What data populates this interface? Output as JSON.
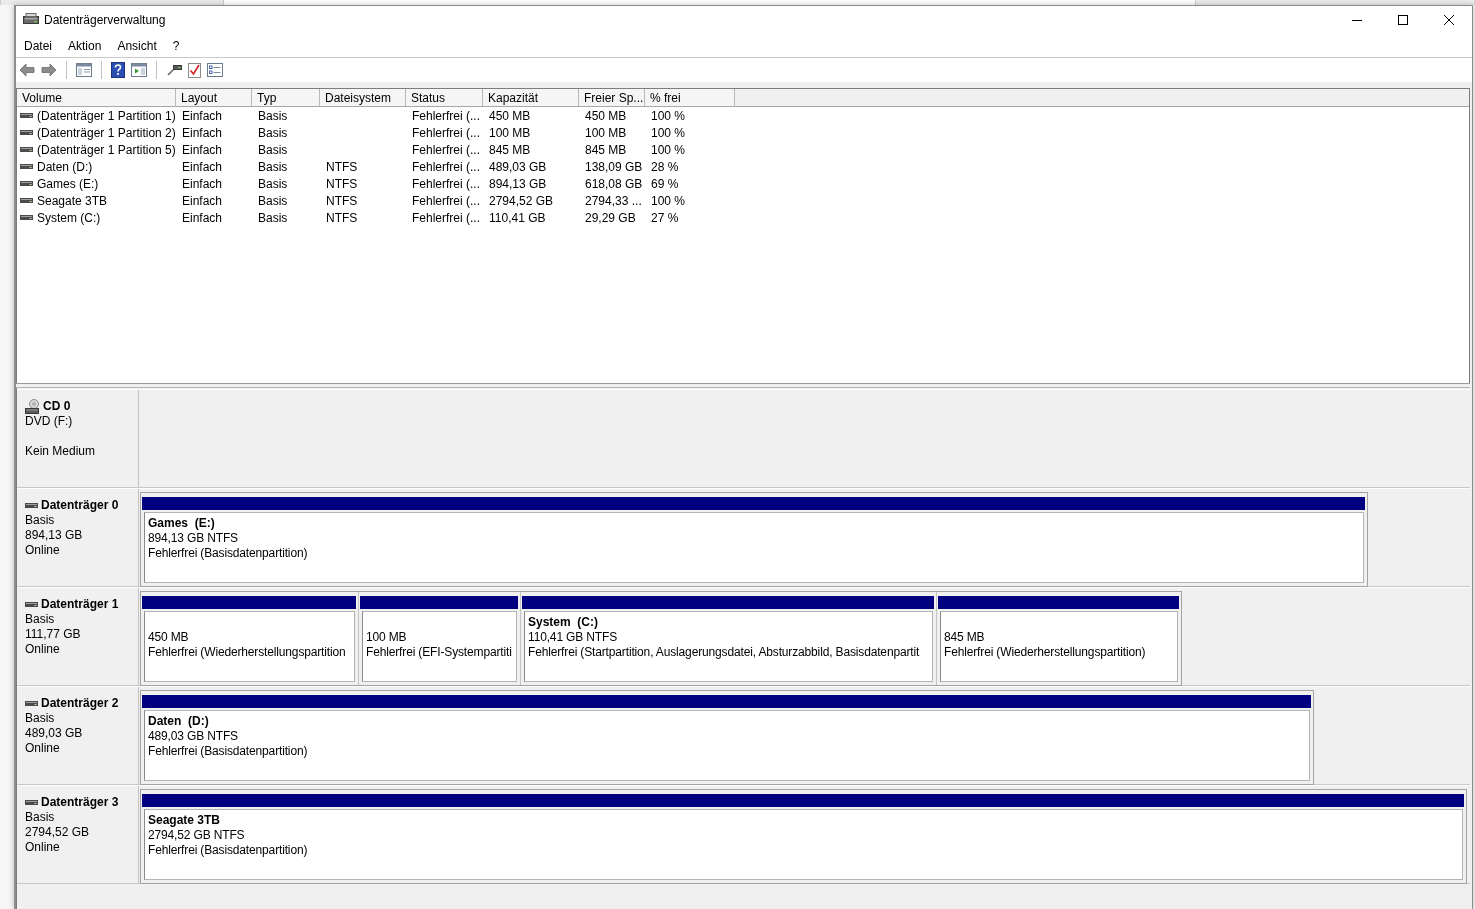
{
  "window": {
    "title": "Datenträgerverwaltung"
  },
  "menu": [
    "Datei",
    "Aktion",
    "Ansicht",
    "?"
  ],
  "volume_list": {
    "columns": [
      "Volume",
      "Layout",
      "Typ",
      "Dateisystem",
      "Status",
      "Kapazität",
      "Freier Sp...",
      "% frei"
    ],
    "rows": [
      {
        "volume": "(Datenträger 1 Partition 1)",
        "layout": "Einfach",
        "type": "Basis",
        "status": "Fehlerfrei (...",
        "capacity": "450 MB",
        "free_space": "450 MB",
        "percent_free": "100 %"
      },
      {
        "volume": "(Datenträger 1 Partition 2)",
        "layout": "Einfach",
        "type": "Basis",
        "status": "Fehlerfrei (...",
        "capacity": "100 MB",
        "free_space": "100 MB",
        "percent_free": "100 %"
      },
      {
        "volume": "(Datenträger 1 Partition 5)",
        "layout": "Einfach",
        "type": "Basis",
        "status": "Fehlerfrei (...",
        "capacity": "845 MB",
        "free_space": "845 MB",
        "percent_free": "100 %"
      },
      {
        "volume": "Daten (D:)",
        "layout": "Einfach",
        "type": "Basis",
        "file_system": "NTFS",
        "status": "Fehlerfrei (...",
        "capacity": "489,03 GB",
        "free_space": "138,09 GB",
        "percent_free": "28 %"
      },
      {
        "volume": "Games (E:)",
        "layout": "Einfach",
        "type": "Basis",
        "file_system": "NTFS",
        "status": "Fehlerfrei (...",
        "capacity": "894,13 GB",
        "free_space": "618,08 GB",
        "percent_free": "69 %"
      },
      {
        "volume": "Seagate 3TB",
        "layout": "Einfach",
        "type": "Basis",
        "file_system": "NTFS",
        "status": "Fehlerfrei (...",
        "capacity": "2794,52 GB",
        "free_space": "2794,33 ...",
        "percent_free": "100 %"
      },
      {
        "volume": "System (C:)",
        "layout": "Einfach",
        "type": "Basis",
        "file_system": "NTFS",
        "status": "Fehlerfrei (...",
        "capacity": "110,41 GB",
        "free_space": "29,29 GB",
        "percent_free": "27 %"
      }
    ]
  },
  "disks": [
    {
      "kind": "cdrom",
      "name": "CD 0",
      "drive": "DVD (F:)",
      "media": "Kein Medium"
    },
    {
      "kind": "disk",
      "name": "Datenträger 0",
      "type": "Basis",
      "size": "894,13 GB",
      "state": "Online",
      "partitions": [
        {
          "title": "Games  (E:)",
          "size": "894,13 GB NTFS",
          "status": "Fehlerfrei (Basisdatenpartition)"
        }
      ]
    },
    {
      "kind": "disk",
      "name": "Datenträger 1",
      "type": "Basis",
      "size": "111,77 GB",
      "state": "Online",
      "partitions": [
        {
          "size": "450 MB",
          "status": "Fehlerfrei (Wiederherstellungspartition"
        },
        {
          "size": "100 MB",
          "status": "Fehlerfrei (EFI-Systempartiti"
        },
        {
          "title": "System  (C:)",
          "size": "110,41 GB NTFS",
          "status": "Fehlerfrei (Startpartition, Auslagerungsdatei, Absturzabbild, Basisdatenpartit"
        },
        {
          "size": "845 MB",
          "status": "Fehlerfrei (Wiederherstellungspartition)"
        }
      ]
    },
    {
      "kind": "disk",
      "name": "Datenträger 2",
      "type": "Basis",
      "size": "489,03 GB",
      "state": "Online",
      "partitions": [
        {
          "title": "Daten  (D:)",
          "size": "489,03 GB NTFS",
          "status": "Fehlerfrei (Basisdatenpartition)"
        }
      ]
    },
    {
      "kind": "disk",
      "name": "Datenträger 3",
      "type": "Basis",
      "size": "2794,52 GB",
      "state": "Online",
      "partitions": [
        {
          "title": "Seagate 3TB",
          "size": "2794,52 GB NTFS",
          "status": "Fehlerfrei (Basisdatenpartition)"
        }
      ]
    }
  ]
}
